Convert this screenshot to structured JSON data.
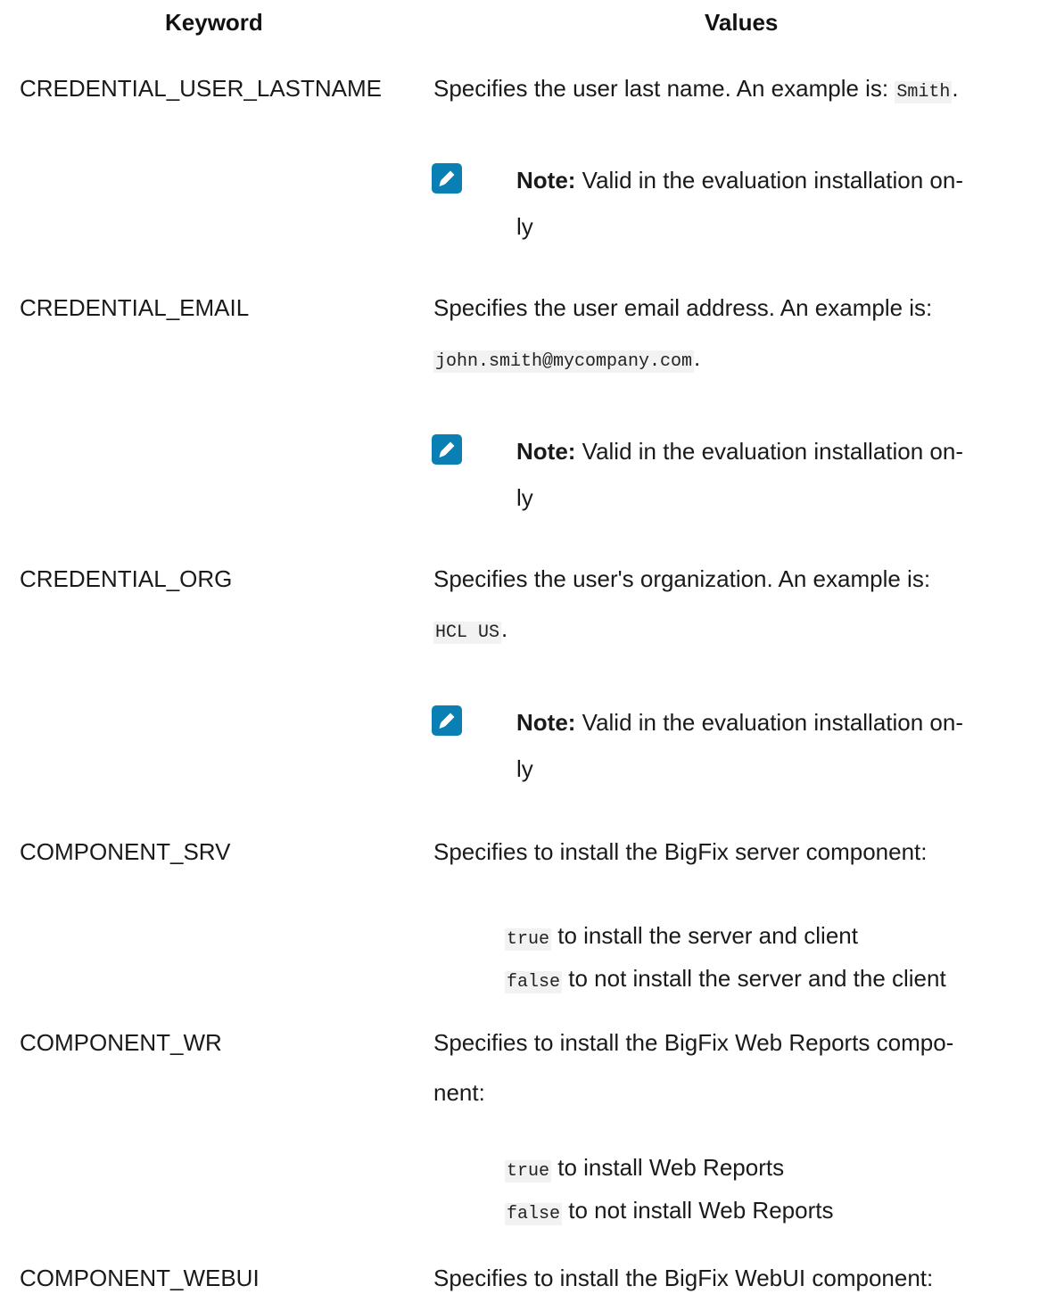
{
  "table": {
    "headers": {
      "keyword": "Keyword",
      "values": "Values"
    },
    "rows": [
      {
        "keyword": "CREDENTIAL_USER_LASTNAME",
        "desc": "Specifies the user last name. An example is: ",
        "example": "Smith",
        "note_label": "Note:",
        "note_text": " Valid in the evaluation installation on-",
        "note_text2": "ly"
      },
      {
        "keyword": "CREDENTIAL_EMAIL",
        "desc": "Specifies the user email address. An example is:",
        "example": "john.smith@mycompany.com",
        "note_label": "Note:",
        "note_text": " Valid in the evaluation installation on-",
        "note_text2": "ly"
      },
      {
        "keyword": "CREDENTIAL_ORG",
        "desc": "Specifies the user's organization. An example is:",
        "example": "HCL US",
        "note_label": "Note:",
        "note_text": " Valid in the evaluation installation on-",
        "note_text2": "ly"
      },
      {
        "keyword": "COMPONENT_SRV",
        "desc": "Specifies to install the BigFix server component:",
        "options": [
          {
            "code": "true",
            "text": " to install the server and client"
          },
          {
            "code": "false",
            "text": " to not install the server and the client"
          }
        ]
      },
      {
        "keyword": "COMPONENT_WR",
        "desc": "Specifies to install the BigFix Web Reports compo-",
        "desc2": "nent:",
        "options": [
          {
            "code": "true",
            "text": " to install Web Reports"
          },
          {
            "code": "false",
            "text": " to not install Web Reports"
          }
        ]
      },
      {
        "keyword": "COMPONENT_WEBUI",
        "desc": "Specifies to install the BigFix WebUI component:"
      }
    ]
  },
  "punct": {
    "period": "."
  },
  "icons": {
    "note": "note-pencil-icon"
  },
  "colors": {
    "note_icon": "#0a7fb4"
  }
}
